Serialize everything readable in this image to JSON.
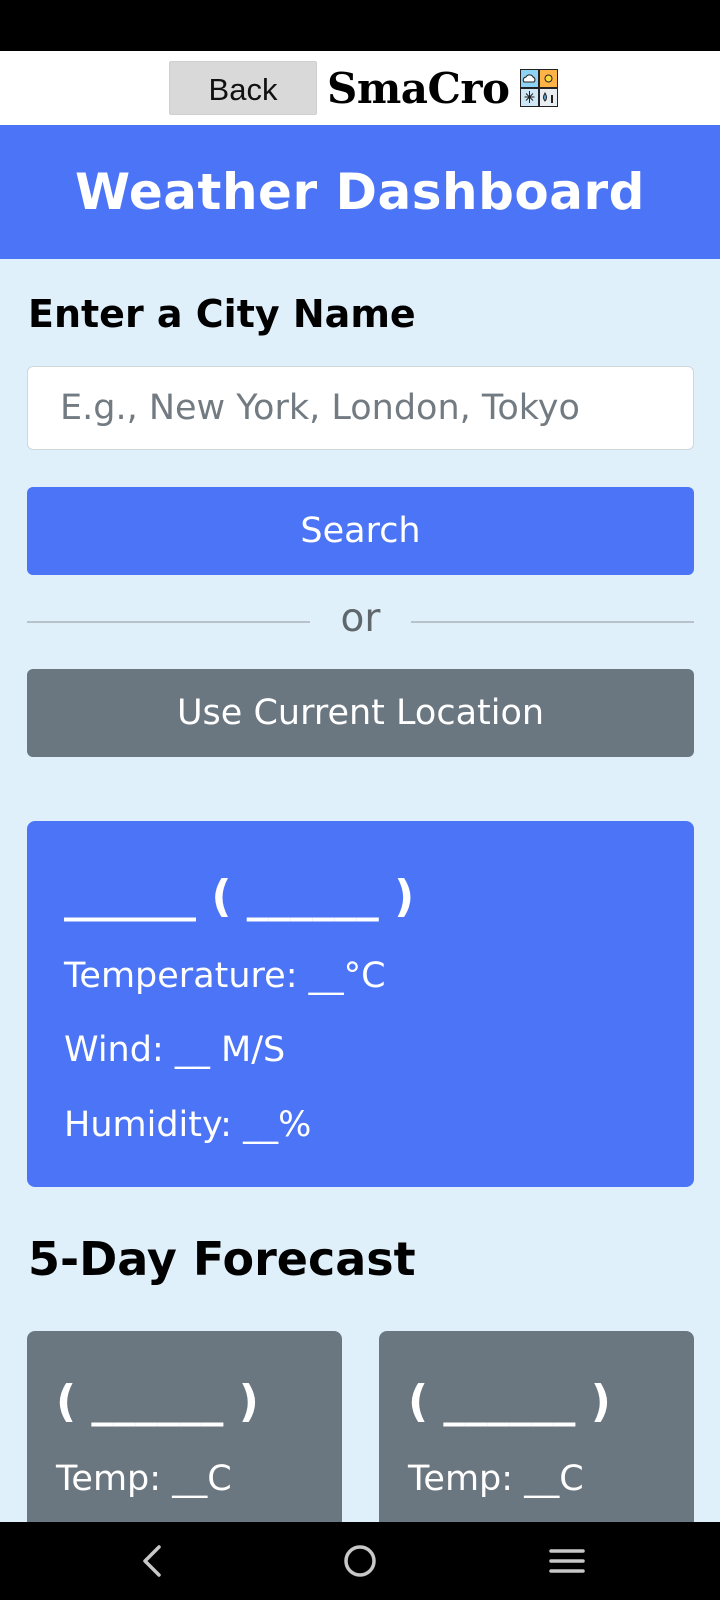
{
  "header": {
    "back_label": "Back",
    "brand": "SmaCro",
    "logo_icon": "weather-tiles-icon"
  },
  "banner": {
    "title": "Weather Dashboard"
  },
  "search": {
    "heading": "Enter a City Name",
    "placeholder": "E.g., New York, London, Tokyo",
    "value": "",
    "search_label": "Search",
    "divider_text": "or",
    "location_label": "Use Current Location"
  },
  "current": {
    "title": "______ ( ______ )",
    "temperature": "Temperature: __°C",
    "wind": "Wind: __ M/S",
    "humidity": "Humidity: __%"
  },
  "forecast": {
    "heading": "5-Day Forecast",
    "days": [
      {
        "date": "( ______ )",
        "temp": "Temp: __C"
      },
      {
        "date": "( ______ )",
        "temp": "Temp: __C"
      }
    ]
  },
  "colors": {
    "accent": "#4c74f6",
    "secondary": "#6b7780",
    "page_bg": "#e0f0fb"
  },
  "nav": {
    "back_icon": "chevron-left-icon",
    "home_icon": "circle-home-icon",
    "menu_icon": "menu-lines-icon"
  }
}
